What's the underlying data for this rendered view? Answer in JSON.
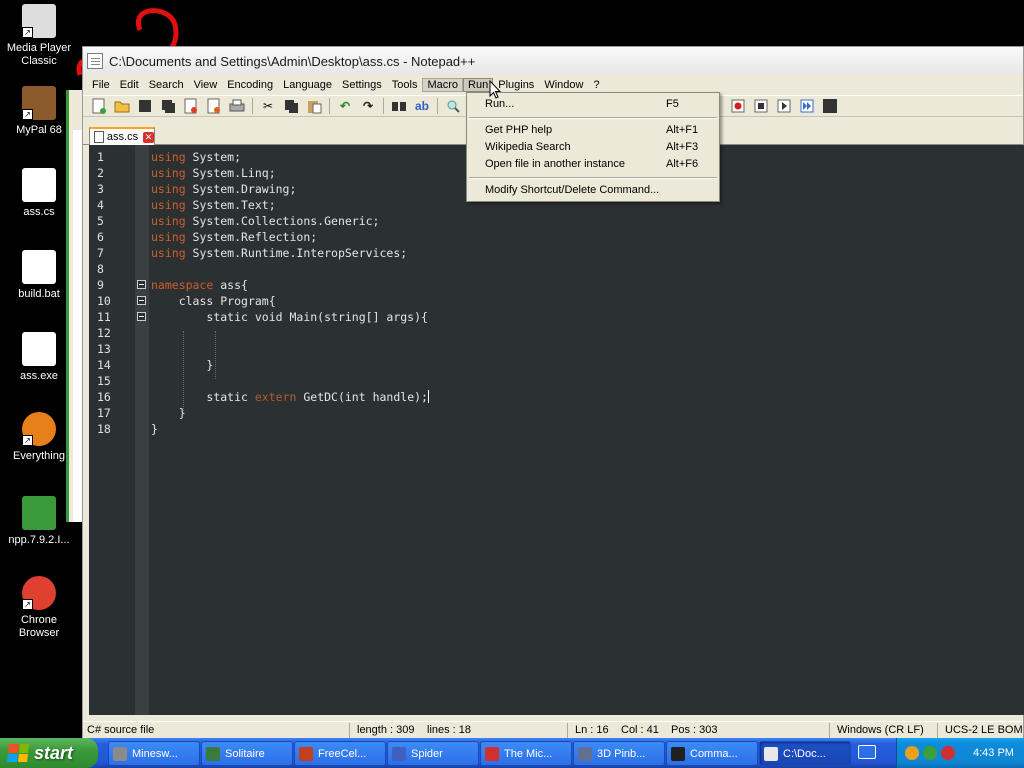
{
  "desktop": {
    "icons": [
      {
        "name": "media-player-classic-icon",
        "label": "Media Player Classic",
        "shortcut": true
      },
      {
        "name": "mypal-icon",
        "label": "MyPal 68",
        "shortcut": true
      },
      {
        "name": "cs-file-icon",
        "label": "ass.cs",
        "shortcut": false
      },
      {
        "name": "bat-file-icon",
        "label": "build.bat",
        "shortcut": false
      },
      {
        "name": "exe-file-icon",
        "label": "ass.exe",
        "shortcut": false
      },
      {
        "name": "everything-icon",
        "label": "Everything",
        "shortcut": true
      },
      {
        "name": "npp-installer-icon",
        "label": "npp.7.9.2.I...",
        "shortcut": false
      },
      {
        "name": "chrome-icon",
        "label": "Chrone Browser",
        "shortcut": true
      }
    ]
  },
  "window": {
    "title": "C:\\Documents and Settings\\Admin\\Desktop\\ass.cs - Notepad++"
  },
  "menubar": {
    "items": [
      "File",
      "Edit",
      "Search",
      "View",
      "Encoding",
      "Language",
      "Settings",
      "Tools",
      "Macro",
      "Run",
      "Plugins",
      "Window",
      "?"
    ]
  },
  "tab": {
    "label": "ass.cs"
  },
  "editor": {
    "lines": [
      {
        "n": "1",
        "kw": "using",
        "rest": " System;"
      },
      {
        "n": "2",
        "kw": "using",
        "rest": " System.Linq;"
      },
      {
        "n": "3",
        "kw": "using",
        "rest": " System.Drawing;"
      },
      {
        "n": "4",
        "kw": "using",
        "rest": " System.Text;"
      },
      {
        "n": "5",
        "kw": "using",
        "rest": " System.Collections.Generic;"
      },
      {
        "n": "6",
        "kw": "using",
        "rest": " System.Reflection;"
      },
      {
        "n": "7",
        "kw": "using",
        "rest": " System.Runtime.InteropServices;"
      },
      {
        "n": "8",
        "kw": "",
        "rest": ""
      },
      {
        "n": "9",
        "kw": "namespace",
        "rest": " ass{"
      },
      {
        "n": "10",
        "kw": "class",
        "rest": " Program{"
      },
      {
        "n": "11",
        "kw": "static void",
        "rest": " Main(string[] args){"
      },
      {
        "n": "12",
        "kw": "",
        "rest": ""
      },
      {
        "n": "13",
        "kw": "",
        "rest": ""
      },
      {
        "n": "14",
        "kw": "",
        "rest": "}"
      },
      {
        "n": "15",
        "kw": "",
        "rest": ""
      },
      {
        "n": "16",
        "kw": "static",
        "kw2": "extern",
        "rest": " GetDC(int handle);"
      },
      {
        "n": "17",
        "kw": "",
        "rest": "}"
      },
      {
        "n": "18",
        "kw": "",
        "rest": "}"
      }
    ]
  },
  "run_menu": {
    "items": [
      {
        "label": "Run...",
        "shortcut": "F5"
      },
      {
        "label": "Get PHP help",
        "shortcut": "Alt+F1"
      },
      {
        "label": "Wikipedia Search",
        "shortcut": "Alt+F3"
      },
      {
        "label": "Open file in another instance",
        "shortcut": "Alt+F6"
      },
      {
        "label": "Modify Shortcut/Delete Command...",
        "shortcut": ""
      }
    ]
  },
  "statusbar": {
    "file_type": "C# source file",
    "length": "length : 309",
    "lines": "lines : 18",
    "ln": "Ln : 16",
    "col": "Col : 41",
    "pos": "Pos : 303",
    "eol": "Windows (CR LF)",
    "encoding": "UCS-2 LE BOM"
  },
  "taskbar": {
    "start_label": "start",
    "buttons": [
      {
        "label": "Minesw...",
        "color": "#8a8a8a",
        "active": false
      },
      {
        "label": "Solitaire",
        "color": "#3a7a3a",
        "active": false
      },
      {
        "label": "FreeCel...",
        "color": "#c04020",
        "active": false
      },
      {
        "label": "Spider",
        "color": "#4060c0",
        "active": false
      },
      {
        "label": "The Mic...",
        "color": "#d03030",
        "active": false
      },
      {
        "label": "3D Pinb...",
        "color": "#607090",
        "active": false
      },
      {
        "label": "Comma...",
        "color": "#202020",
        "active": false
      },
      {
        "label": "C:\\Doc...",
        "color": "#e8e8e8",
        "active": true
      }
    ],
    "clock": "4:43 PM"
  }
}
